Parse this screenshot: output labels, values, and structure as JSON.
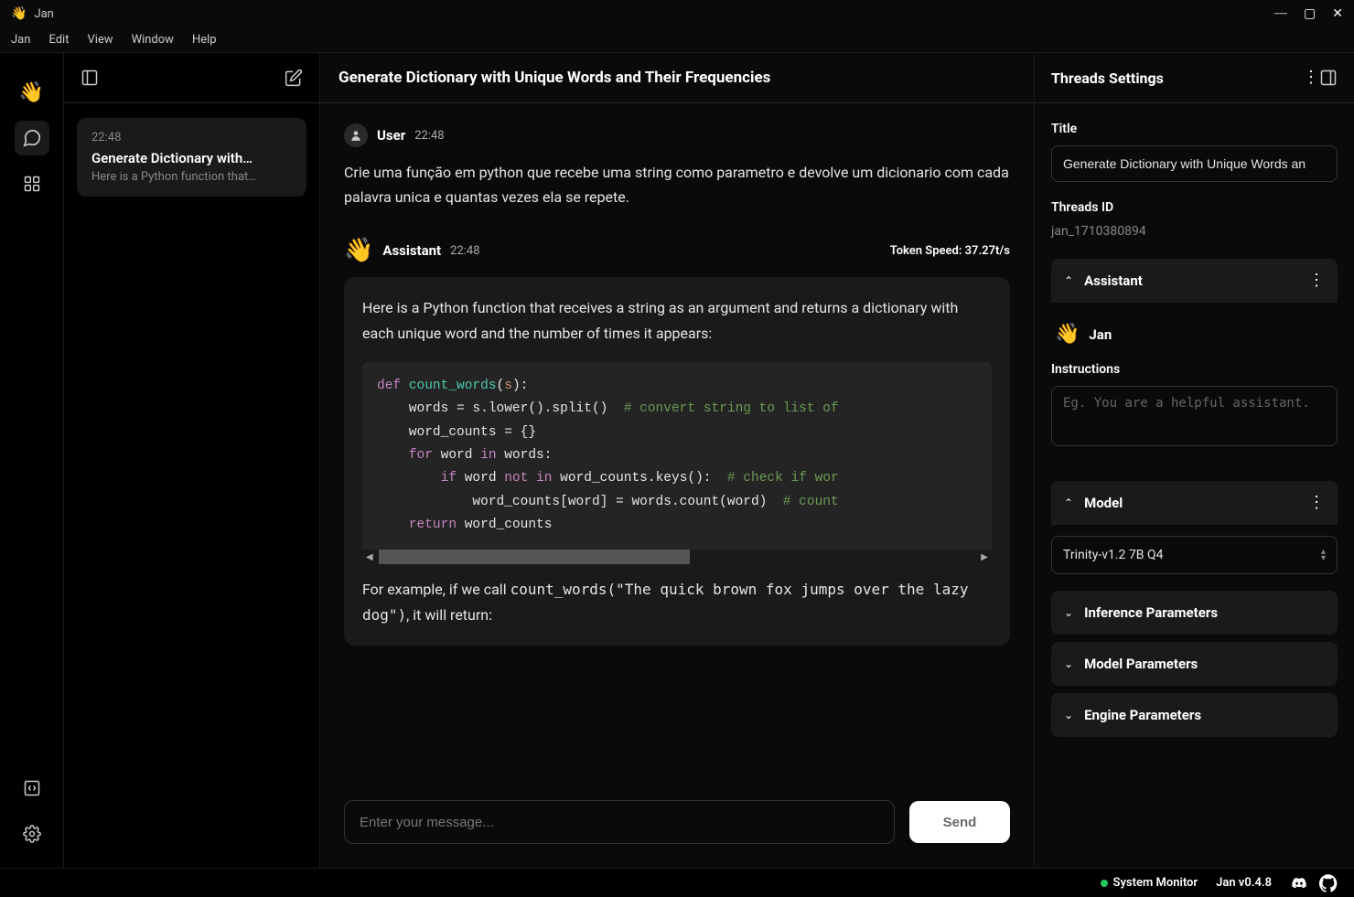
{
  "titlebar": {
    "app_name": "Jan"
  },
  "menubar": {
    "items": [
      "Jan",
      "Edit",
      "View",
      "Window",
      "Help"
    ]
  },
  "threads": {
    "active": {
      "time": "22:48",
      "title": "Generate Dictionary with…",
      "preview": "Here is a Python function that…"
    }
  },
  "chat": {
    "title": "Generate Dictionary with Unique Words and Their Frequencies",
    "user": {
      "name": "User",
      "time": "22:48",
      "text": "Crie uma função em python que recebe uma string como parametro e devolve um dicionario com cada palavra unica e quantas vezes ela se repete."
    },
    "assistant": {
      "name": "Assistant",
      "time": "22:48",
      "token_speed": "Token Speed: 37.27t/s",
      "intro": "Here is a Python function that receives a string as an argument and returns a dictionary with each unique word and the number of times it appears:",
      "outro_prefix": "For example, if we call ",
      "outro_code": "count_words(\"The quick brown fox jumps over the lazy dog\")",
      "outro_suffix": ", it will return:"
    },
    "input_placeholder": "Enter your message...",
    "send_label": "Send"
  },
  "settings": {
    "header": "Threads Settings",
    "title_label": "Title",
    "title_value": "Generate Dictionary with Unique Words an",
    "threads_id_label": "Threads ID",
    "threads_id_value": "jan_1710380894",
    "assistant_label": "Assistant",
    "jan_label": "Jan",
    "instructions_label": "Instructions",
    "instructions_placeholder": "Eg. You are a helpful assistant.",
    "model_label": "Model",
    "model_value": "Trinity-v1.2 7B Q4",
    "inference_label": "Inference Parameters",
    "modelparams_label": "Model Parameters",
    "engine_label": "Engine Parameters"
  },
  "statusbar": {
    "system_monitor": "System Monitor",
    "version": "Jan v0.4.8"
  }
}
